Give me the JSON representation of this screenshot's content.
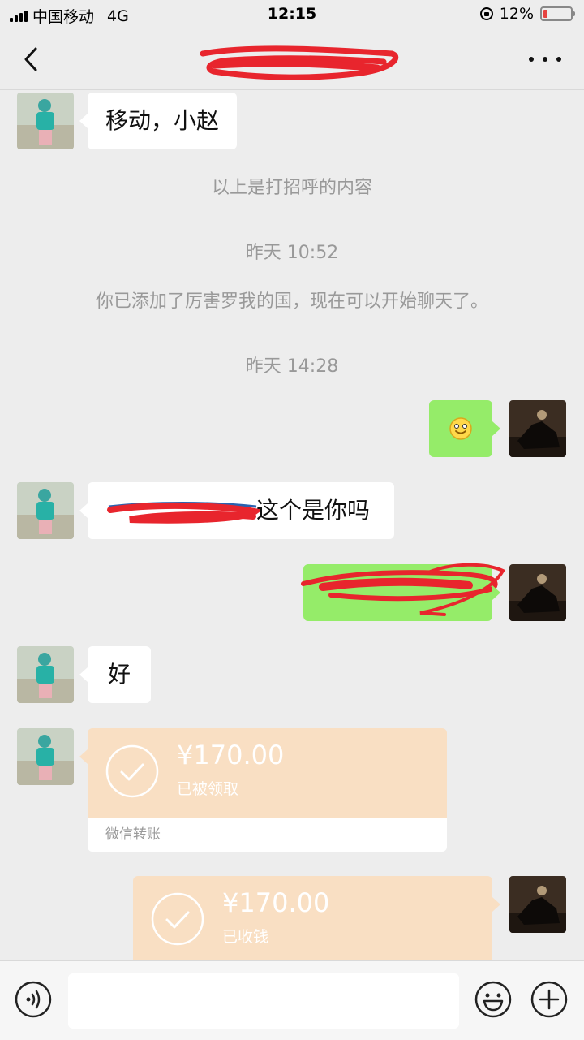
{
  "status_bar": {
    "carrier": "中国移动",
    "network": "4G",
    "time": "12:15",
    "battery": "12%"
  },
  "nav": {
    "back_icon": "chevron-left-icon",
    "more_icon": "more-dots-icon"
  },
  "messages": {
    "m1_text": "移动，小赵",
    "sys_greeting": "以上是打招呼的内容",
    "time1": "昨天 10:52",
    "sys_added": "你已添加了厉害罗我的国，现在可以开始聊天了。",
    "time2": "昨天 14:28",
    "m3_text": "这个是你吗",
    "m5_text": "好",
    "transfer1": {
      "amount": "¥170.00",
      "status": "已被领取",
      "footer": "微信转账"
    },
    "transfer2": {
      "amount": "¥170.00",
      "status": "已收钱"
    }
  },
  "colors": {
    "bg": "#ededed",
    "bubble_self": "#95ec69",
    "transfer": "#f9dfc3",
    "redaction": "#e8252d"
  }
}
